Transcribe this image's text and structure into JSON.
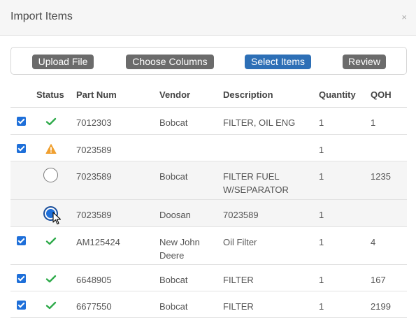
{
  "modal": {
    "title": "Import Items",
    "close_label": "×"
  },
  "steps": [
    {
      "label": "Upload File",
      "active": false
    },
    {
      "label": "Choose Columns",
      "active": false
    },
    {
      "label": "Select Items",
      "active": true
    },
    {
      "label": "Review",
      "active": false
    }
  ],
  "table": {
    "headers": {
      "status": "Status",
      "part": "Part Num",
      "vendor": "Vendor",
      "description": "Description",
      "quantity": "Quantity",
      "qoh": "QOH"
    },
    "rows": [
      {
        "checked": true,
        "status": "check",
        "part": "7012303",
        "vendor": "Bobcat",
        "description": "FILTER, OIL ENG",
        "quantity": "1",
        "qoh": "1"
      },
      {
        "checked": true,
        "status": "warning",
        "part": "7023589",
        "vendor": "",
        "description": "",
        "quantity": "1",
        "qoh": ""
      },
      {
        "checked": false,
        "status": "radio-off",
        "part": "7023589",
        "vendor": "Bobcat",
        "description": "FILTER FUEL W/SEPARATOR",
        "quantity": "1",
        "qoh": "1235"
      },
      {
        "checked": false,
        "status": "radio-on",
        "part": "7023589",
        "vendor": "Doosan",
        "description": "7023589",
        "quantity": "1",
        "qoh": ""
      },
      {
        "checked": true,
        "status": "check",
        "part": "AM125424",
        "vendor": "New John Deere",
        "description": "Oil Filter",
        "quantity": "1",
        "qoh": "4"
      },
      {
        "checked": true,
        "status": "check",
        "part": "6648905",
        "vendor": "Bobcat",
        "description": "FILTER",
        "quantity": "1",
        "qoh": "167"
      },
      {
        "checked": true,
        "status": "check",
        "part": "6677550",
        "vendor": "Bobcat",
        "description": "FILTER",
        "quantity": "1",
        "qoh": "2199"
      }
    ]
  },
  "colors": {
    "accent": "#2d6fb6",
    "step_inactive": "#6b6b6b",
    "check_green": "#2eaa4a",
    "warning_orange": "#f0a030"
  }
}
